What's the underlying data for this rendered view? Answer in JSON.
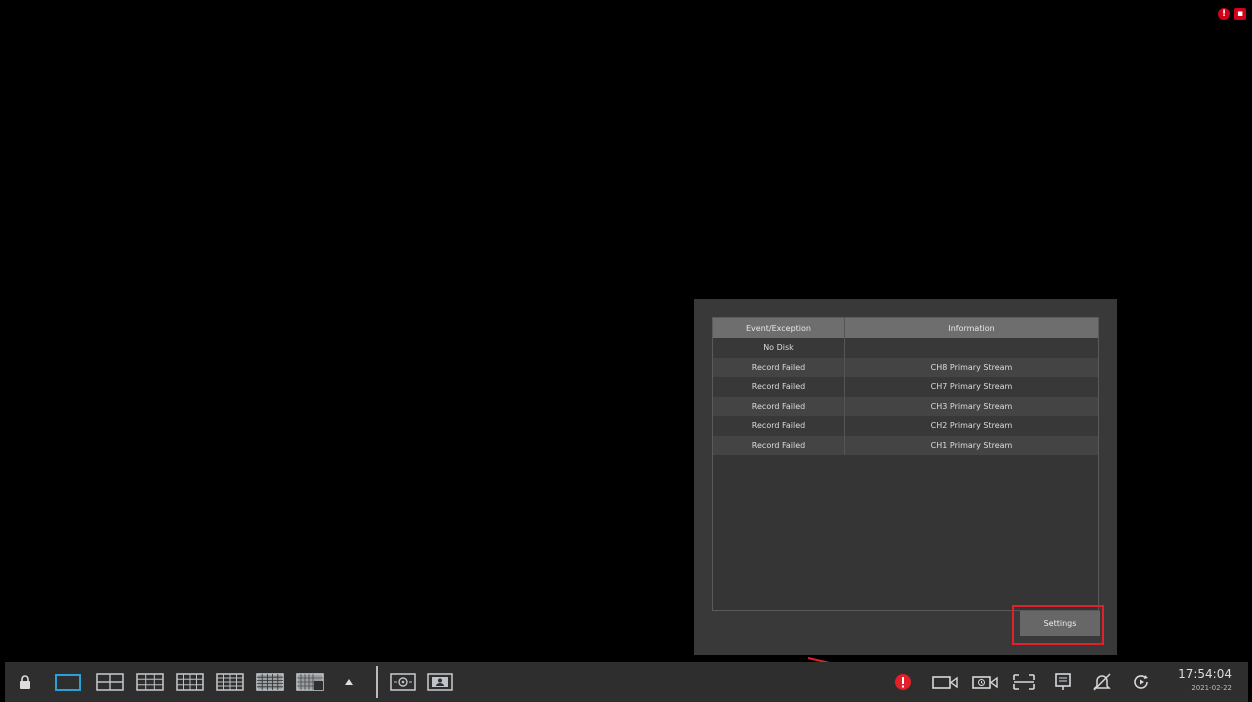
{
  "popup": {
    "columns": [
      "Event/Exception",
      "Information"
    ],
    "rows": [
      {
        "event": "No Disk",
        "info": ""
      },
      {
        "event": "Record Failed",
        "info": "CH8 Primary Stream"
      },
      {
        "event": "Record Failed",
        "info": "CH7 Primary Stream"
      },
      {
        "event": "Record Failed",
        "info": "CH3 Primary Stream"
      },
      {
        "event": "Record Failed",
        "info": "CH2 Primary Stream"
      },
      {
        "event": "Record Failed",
        "info": "CH1 Primary Stream"
      }
    ],
    "settings_label": "Settings"
  },
  "toolbar": {
    "time": "17:54:04",
    "date": "2021-02-22"
  },
  "colors": {
    "accent": "#29a0d8",
    "alert": "#e0202a"
  }
}
